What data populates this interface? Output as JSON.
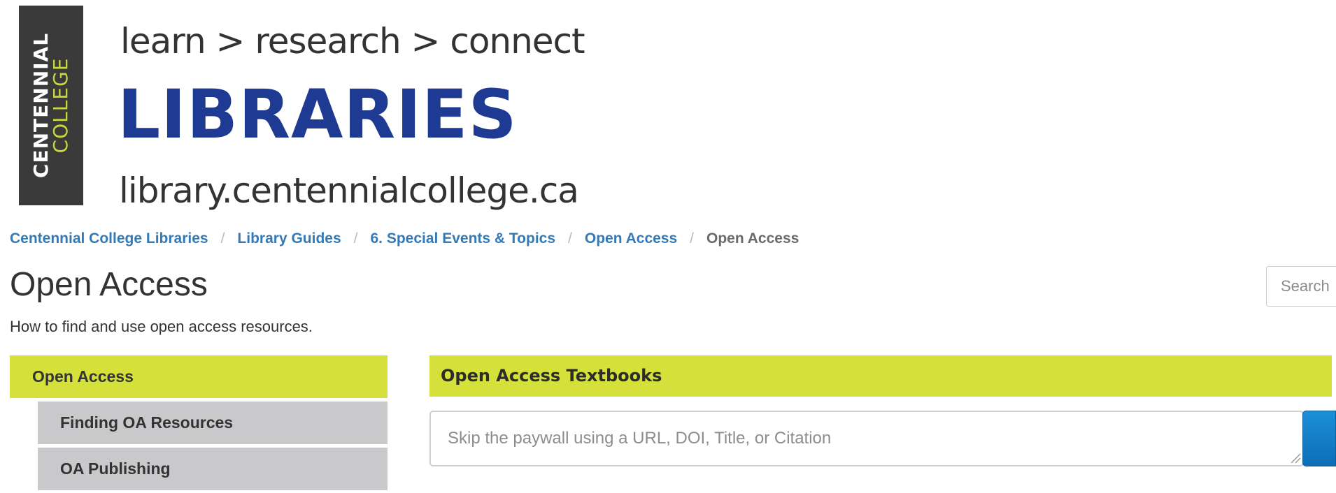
{
  "banner": {
    "logo_line1": "CENTENNIAL",
    "logo_line2": "COLLEGE",
    "tagline": "learn > research > connect",
    "title": "LIBRARIES",
    "url": "library.centennialcollege.ca"
  },
  "breadcrumb": {
    "items": [
      "Centennial College Libraries",
      "Library Guides",
      "6. Special Events & Topics",
      "Open Access"
    ],
    "current": "Open Access",
    "separator": "/"
  },
  "page": {
    "title": "Open Access",
    "description": "How to find and use open access resources."
  },
  "search": {
    "placeholder": "Search"
  },
  "side_nav": {
    "active": "Open Access",
    "items": [
      "Finding OA Resources",
      "OA Publishing"
    ]
  },
  "main": {
    "panel_title": "Open Access Textbooks",
    "input_placeholder": "Skip the paywall using a URL, DOI, Title, or Citation"
  },
  "colors": {
    "accent_green": "#d5e03a",
    "brand_blue": "#1f3a93",
    "link_blue": "#337ab7",
    "nav_gray": "#c9c9cb",
    "logo_dark": "#3a3a3a"
  }
}
